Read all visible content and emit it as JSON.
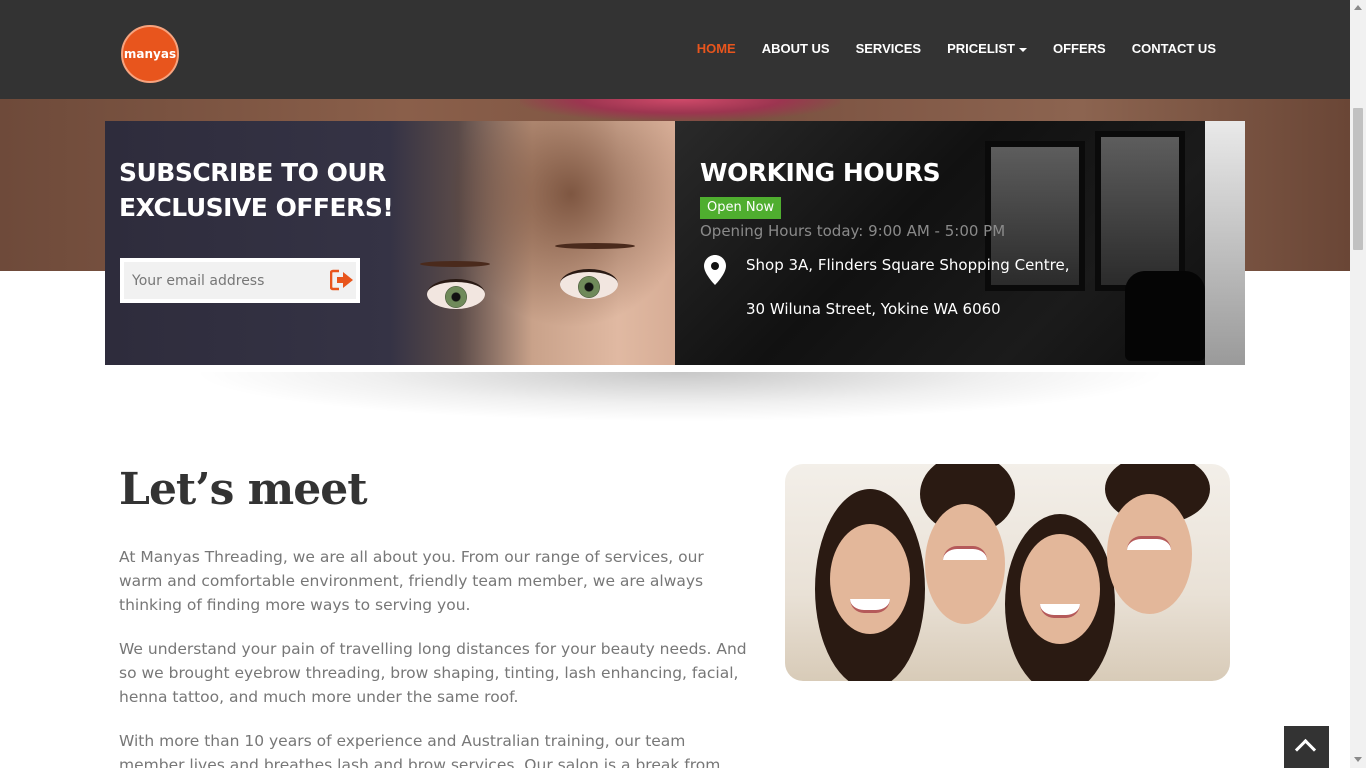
{
  "brand": {
    "logo_text": "manyas"
  },
  "nav": {
    "items": [
      {
        "label": "HOME",
        "active": true
      },
      {
        "label": "ABOUT US"
      },
      {
        "label": "SERVICES"
      },
      {
        "label": "PRICELIST",
        "dropdown": true
      },
      {
        "label": "OFFERS"
      },
      {
        "label": "CONTACT US"
      }
    ]
  },
  "subscribe": {
    "title": "SUBSCRIBE TO OUR EXCLUSIVE OFFERS!",
    "email_placeholder": "Your email address"
  },
  "hours": {
    "title": "WORKING HOURS",
    "status_badge": "Open Now",
    "today": "Opening Hours today: 9:00 AM - 5:00 PM",
    "address_line1": "Shop 3A, Flinders Square Shopping Centre,",
    "address_line2": "30 Wiluna Street, Yokine WA 6060"
  },
  "about": {
    "heading": "Let’s meet",
    "paragraphs": [
      "At Manyas Threading, we are all about you. From our range of services, our warm and comfortable environment, friendly team member, we are always thinking of finding more ways to serving you.",
      "We understand your pain of travelling long distances for your beauty needs. And so we brought eyebrow threading, brow shaping, tinting, lash enhancing, facial, henna tattoo, and much more under the same roof.",
      "With more than 10 years of experience and Australian training, our team member lives and breathes lash and brow services. Our salon is a break from"
    ]
  },
  "colors": {
    "accent": "#e8551d",
    "navbar": "#333333",
    "open_badge": "#4fae2f"
  }
}
